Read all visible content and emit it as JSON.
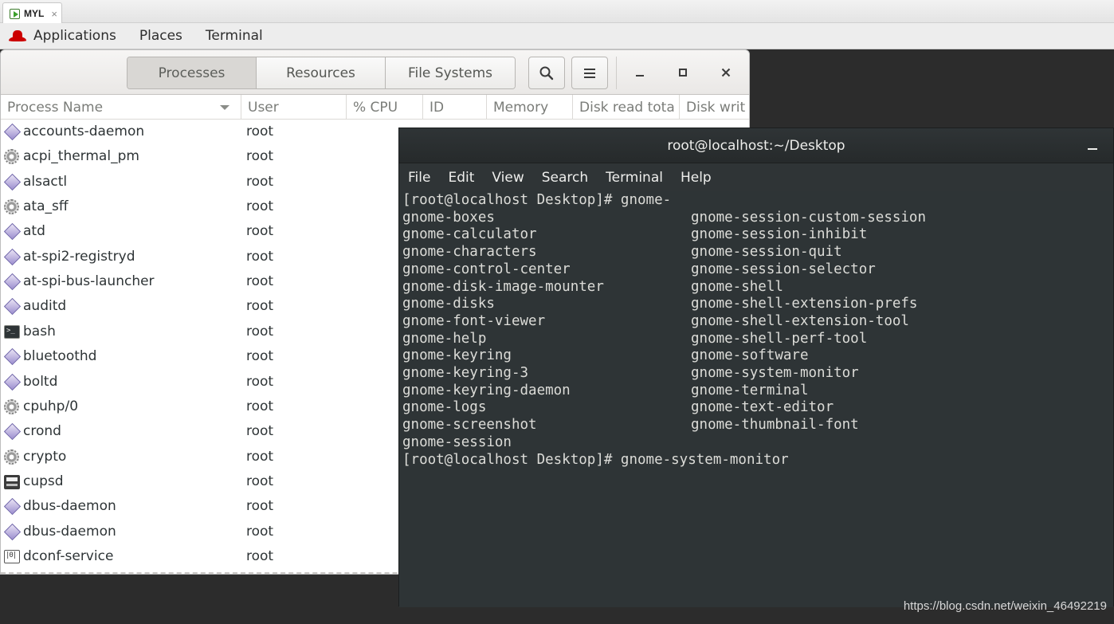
{
  "vm_tab": {
    "label": "MYL",
    "close": "×"
  },
  "topbar": {
    "applications": "Applications",
    "places": "Places",
    "terminal": "Terminal"
  },
  "sysmon": {
    "tabs": [
      "Processes",
      "Resources",
      "File Systems"
    ],
    "active_tab": "Processes",
    "search_icon": "search-icon",
    "menu_icon": "hamburger-icon",
    "columns": [
      "Process Name",
      "User",
      "% CPU",
      "ID",
      "Memory",
      "Disk read tota",
      "Disk writ"
    ],
    "rows": [
      {
        "name": "accounts-daemon",
        "user": "root",
        "icon": "diamond"
      },
      {
        "name": "acpi_thermal_pm",
        "user": "root",
        "icon": "gear"
      },
      {
        "name": "alsactl",
        "user": "root",
        "icon": "diamond"
      },
      {
        "name": "ata_sff",
        "user": "root",
        "icon": "gear"
      },
      {
        "name": "atd",
        "user": "root",
        "icon": "diamond"
      },
      {
        "name": "at-spi2-registryd",
        "user": "root",
        "icon": "diamond"
      },
      {
        "name": "at-spi-bus-launcher",
        "user": "root",
        "icon": "diamond"
      },
      {
        "name": "auditd",
        "user": "root",
        "icon": "diamond"
      },
      {
        "name": "bash",
        "user": "root",
        "icon": "term"
      },
      {
        "name": "bluetoothd",
        "user": "root",
        "icon": "diamond"
      },
      {
        "name": "boltd",
        "user": "root",
        "icon": "diamond"
      },
      {
        "name": "cpuhp/0",
        "user": "root",
        "icon": "gear"
      },
      {
        "name": "crond",
        "user": "root",
        "icon": "diamond"
      },
      {
        "name": "crypto",
        "user": "root",
        "icon": "gear"
      },
      {
        "name": "cupsd",
        "user": "root",
        "icon": "printer"
      },
      {
        "name": "dbus-daemon",
        "user": "root",
        "icon": "diamond"
      },
      {
        "name": "dbus-daemon",
        "user": "root",
        "icon": "diamond"
      },
      {
        "name": "dconf-service",
        "user": "root",
        "icon": "dconf"
      }
    ]
  },
  "terminal": {
    "title": "root@localhost:~/Desktop",
    "menu": [
      "File",
      "Edit",
      "View",
      "Search",
      "Terminal",
      "Help"
    ],
    "prompt1": "[root@localhost Desktop]# gnome-",
    "completions_left": [
      "gnome-boxes",
      "gnome-calculator",
      "gnome-characters",
      "gnome-control-center",
      "gnome-disk-image-mounter",
      "gnome-disks",
      "gnome-font-viewer",
      "gnome-help",
      "gnome-keyring",
      "gnome-keyring-3",
      "gnome-keyring-daemon",
      "gnome-logs",
      "gnome-screenshot",
      "gnome-session"
    ],
    "completions_right": [
      "gnome-session-custom-session",
      "gnome-session-inhibit",
      "gnome-session-quit",
      "gnome-session-selector",
      "gnome-shell",
      "gnome-shell-extension-prefs",
      "gnome-shell-extension-tool",
      "gnome-shell-perf-tool",
      "gnome-software",
      "gnome-system-monitor",
      "gnome-terminal",
      "gnome-text-editor",
      "gnome-thumbnail-font"
    ],
    "prompt2": "[root@localhost Desktop]# gnome-system-monitor"
  },
  "watermark": "https://blog.csdn.net/weixin_46492219"
}
